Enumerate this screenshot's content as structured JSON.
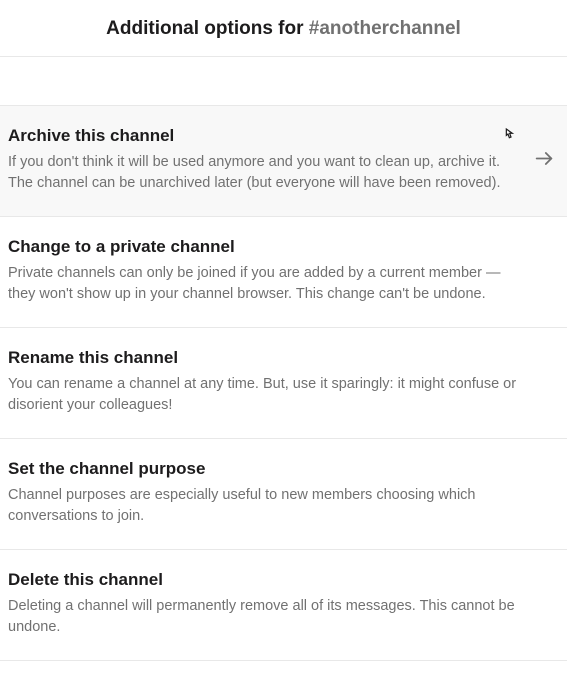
{
  "header": {
    "prefix": "Additional options for ",
    "channel": "#anotherchannel"
  },
  "options": [
    {
      "title": "Archive this channel",
      "desc": "If you don't think it will be used anymore and you want to clean up, archive it. The channel can be unarchived later (but everyone will have been removed)."
    },
    {
      "title": "Change to a private channel",
      "desc": "Private channels can only be joined if you are added by a current member — they won't show up in your channel browser. This change can't be undone."
    },
    {
      "title": "Rename this channel",
      "desc": "You can rename a channel at any time. But, use it sparingly: it might confuse or disorient your colleagues!"
    },
    {
      "title": "Set the channel purpose",
      "desc": "Channel purposes are especially useful to new members choosing which conversations to join."
    },
    {
      "title": "Delete this channel",
      "desc": "Deleting a channel will permanently remove all of its messages. This cannot be undone."
    }
  ]
}
